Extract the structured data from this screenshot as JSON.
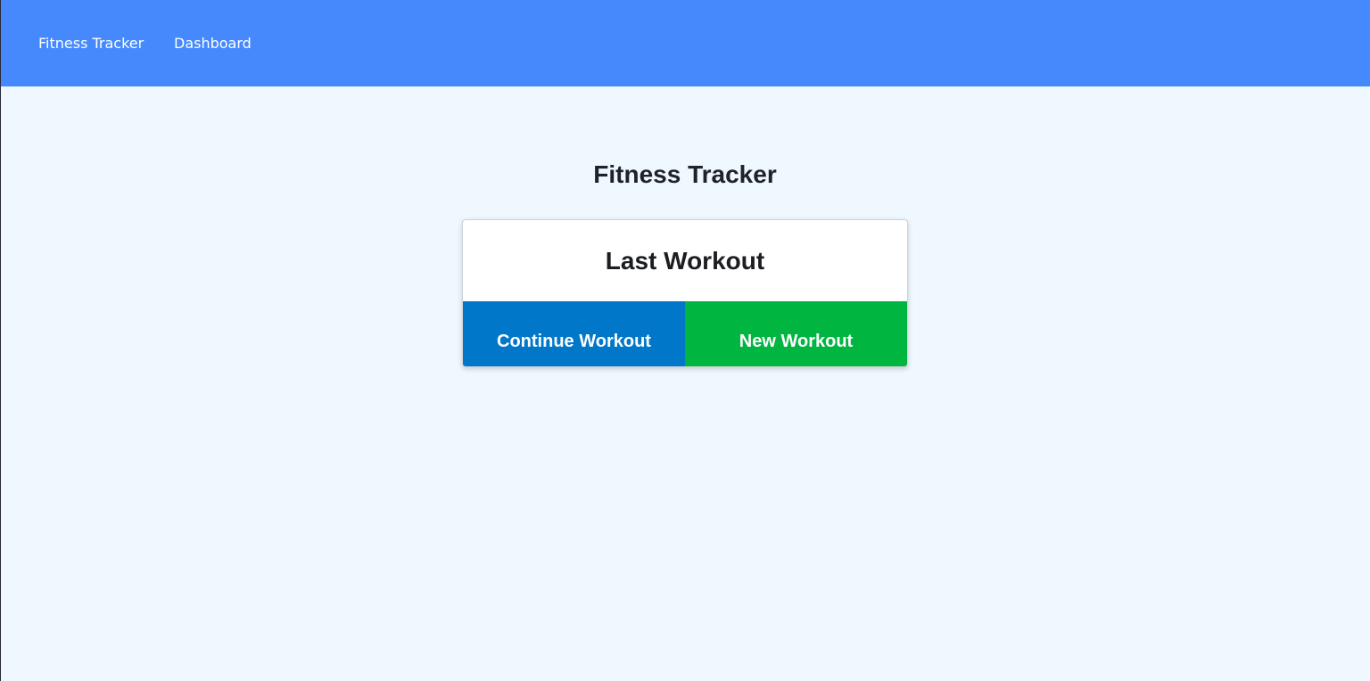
{
  "nav": {
    "brand": "Fitness Tracker",
    "links": [
      "Dashboard"
    ]
  },
  "main": {
    "title": "Fitness Tracker",
    "card": {
      "title": "Last Workout",
      "continue_label": "Continue Workout",
      "new_label": "New Workout"
    }
  },
  "colors": {
    "navbar": "#4589fd",
    "background": "#eff7ff",
    "continue_button": "#0077c8",
    "new_button": "#00b540"
  }
}
